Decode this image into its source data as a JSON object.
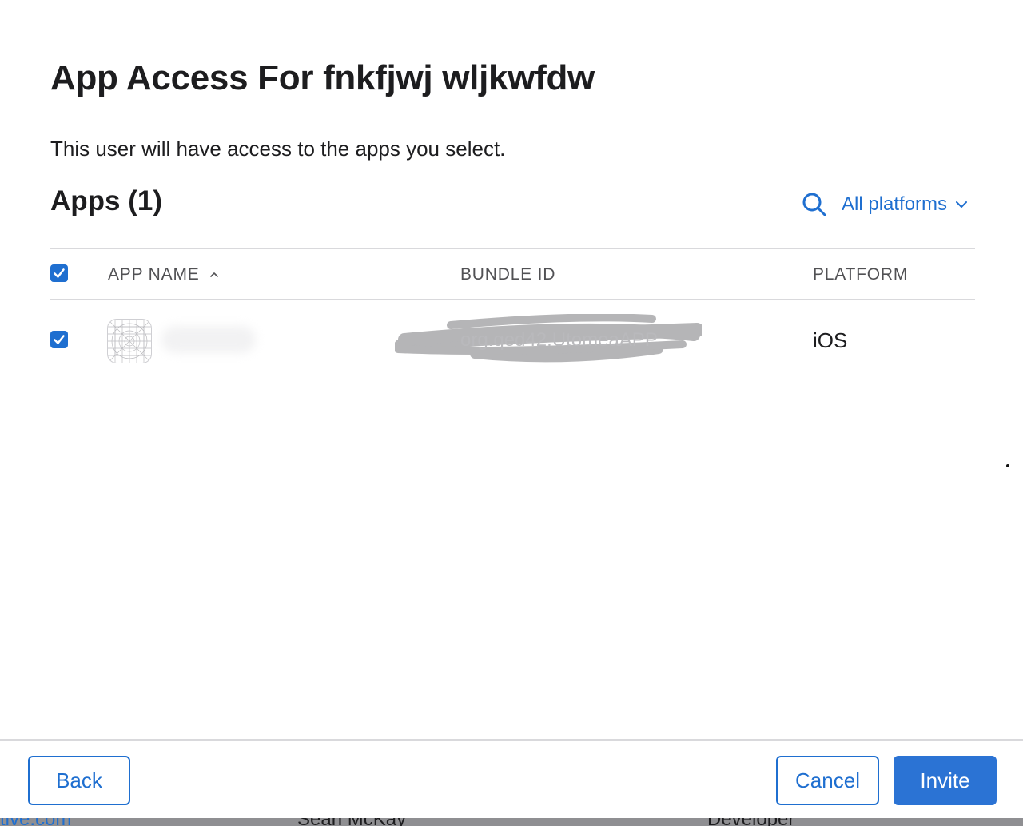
{
  "modal": {
    "title": "App Access For fnkfjwj wljkwfdw",
    "subtitle": "This user will have access to the apps you select.",
    "section_title": "Apps (1)",
    "filter": {
      "label": "All platforms",
      "icon": "chevron-down-icon"
    },
    "search_icon": "search-icon",
    "table": {
      "header_checked": true,
      "columns": [
        "APP NAME",
        "BUNDLE ID",
        "PLATFORM"
      ],
      "sorted_column": "APP NAME",
      "sort_direction": "ascending",
      "rows": [
        {
          "checked": true,
          "app_name": "",
          "bundle_id": "org.qed42.UtomeaAPP",
          "platform": "iOS"
        }
      ]
    },
    "buttons": {
      "back": "Back",
      "cancel": "Cancel",
      "invite": "Invite"
    }
  },
  "background_list": {
    "email_fragment": "tive.com",
    "name": "Sean McKay",
    "role": "Developer"
  },
  "colors": {
    "accent": "#1f6fd0",
    "primary_button": "#2b73d4",
    "divider": "#d9d9dc",
    "text": "#1d1d1f",
    "header_text": "#515154"
  }
}
